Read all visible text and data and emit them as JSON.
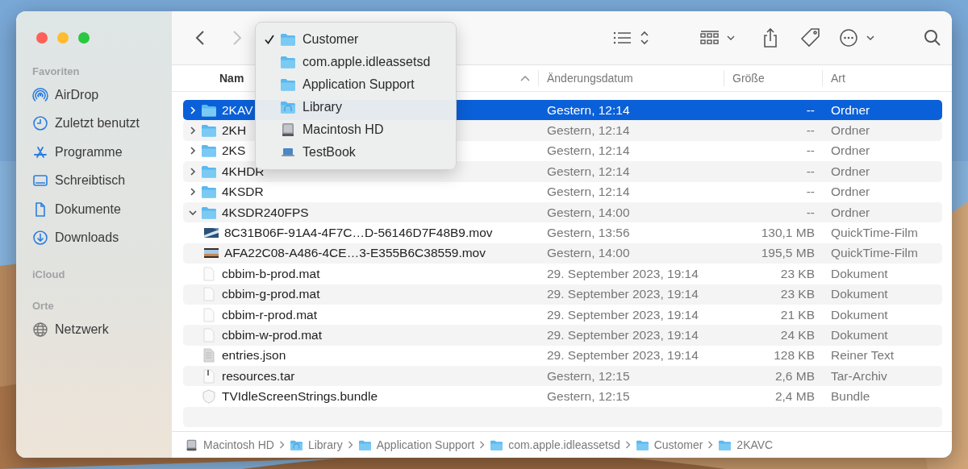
{
  "toolbar": {
    "forward_disabled": true
  },
  "sidebar": [
    {
      "title": "Favoriten",
      "items": [
        {
          "label": "AirDrop"
        },
        {
          "label": "Zuletzt benutzt"
        },
        {
          "label": "Programme"
        },
        {
          "label": "Schreibtisch"
        },
        {
          "label": "Dokumente"
        },
        {
          "label": "Downloads"
        }
      ]
    },
    {
      "title": "iCloud"
    },
    {
      "title": "Orte",
      "items": [
        {
          "label": "Netzwerk"
        }
      ]
    }
  ],
  "table": {
    "columns": [
      {
        "label": "Nam",
        "sorted": true
      },
      {
        "label": "Änderungsdatum",
        "sorted": false
      },
      {
        "label": "Größe",
        "sorted": false
      },
      {
        "label": "Art",
        "sorted": false
      }
    ],
    "rows": [
      {
        "name": "2KAV",
        "date": "Gestern, 12:14",
        "size": "--",
        "kind_label": "Ordner",
        "kind": "folder",
        "expanded": false,
        "selected": true
      },
      {
        "name": "2KH",
        "date": "Gestern, 12:14",
        "size": "--",
        "kind_label": "Ordner",
        "kind": "folder",
        "expanded": false,
        "selected": false
      },
      {
        "name": "2KS",
        "date": "Gestern, 12:14",
        "size": "--",
        "kind_label": "Ordner",
        "kind": "folder",
        "expanded": false,
        "selected": false
      },
      {
        "name": "4KHDR",
        "date": "Gestern, 12:14",
        "size": "--",
        "kind_label": "Ordner",
        "kind": "folder",
        "expanded": false,
        "selected": false
      },
      {
        "name": "4KSDR",
        "date": "Gestern, 12:14",
        "size": "--",
        "kind_label": "Ordner",
        "kind": "folder",
        "expanded": false,
        "selected": false
      },
      {
        "name": "4KSDR240FPS",
        "date": "Gestern, 14:00",
        "size": "--",
        "kind_label": "Ordner",
        "kind": "folder",
        "expanded": true,
        "selected": false,
        "children": [
          {
            "name": "8C31B06F-91A4-4F7C…D-56146D7F48B9.mov",
            "date": "Gestern, 13:56",
            "size": "130,1 MB",
            "kind_label": "QuickTime-Film",
            "kind": "movie",
            "selected": false
          },
          {
            "name": "AFA22C08-A486-4CE…3-E355B6C38559.mov",
            "date": "Gestern, 14:00",
            "size": "195,5 MB",
            "kind_label": "QuickTime-Film",
            "kind": "movie",
            "selected": false
          }
        ]
      },
      {
        "name": "cbbim-b-prod.mat",
        "date": "29. September 2023, 19:14",
        "size": "23 KB",
        "kind_label": "Dokument",
        "kind": "document",
        "selected": false
      },
      {
        "name": "cbbim-g-prod.mat",
        "date": "29. September 2023, 19:14",
        "size": "23 KB",
        "kind_label": "Dokument",
        "kind": "document",
        "selected": false
      },
      {
        "name": "cbbim-r-prod.mat",
        "date": "29. September 2023, 19:14",
        "size": "21 KB",
        "kind_label": "Dokument",
        "kind": "document",
        "selected": false
      },
      {
        "name": "cbbim-w-prod.mat",
        "date": "29. September 2023, 19:14",
        "size": "24 KB",
        "kind_label": "Dokument",
        "kind": "document",
        "selected": false
      },
      {
        "name": "entries.json",
        "date": "29. September 2023, 19:14",
        "size": "128 KB",
        "kind_label": "Reiner Text",
        "kind": "text",
        "selected": false
      },
      {
        "name": "resources.tar",
        "date": "Gestern, 12:15",
        "size": "2,6 MB",
        "kind_label": "Tar-Archiv",
        "kind": "archive",
        "selected": false
      },
      {
        "name": "TVIdleScreenStrings.bundle",
        "date": "Gestern, 12:15",
        "size": "2,4 MB",
        "kind_label": "Bundle",
        "kind": "bundle",
        "selected": false
      }
    ]
  },
  "path_bar": [
    {
      "label": "Macintosh HD",
      "kind": "disk"
    },
    {
      "label": "Library",
      "kind": "library"
    },
    {
      "label": "Application Support",
      "kind": "folder"
    },
    {
      "label": "com.apple.idleassetsd",
      "kind": "folder"
    },
    {
      "label": "Customer",
      "kind": "folder"
    },
    {
      "label": "2KAVC",
      "kind": "folder"
    }
  ],
  "path_menu": [
    {
      "label": "Customer",
      "kind": "folder",
      "checked": true
    },
    {
      "label": "com.apple.idleassetsd",
      "kind": "folder",
      "checked": false
    },
    {
      "label": "Application Support",
      "kind": "folder",
      "checked": false
    },
    {
      "label": "Library",
      "kind": "library",
      "checked": false
    },
    {
      "label": "Macintosh HD",
      "kind": "disk",
      "checked": false
    },
    {
      "label": "TestBook",
      "kind": "laptop",
      "checked": false
    }
  ]
}
